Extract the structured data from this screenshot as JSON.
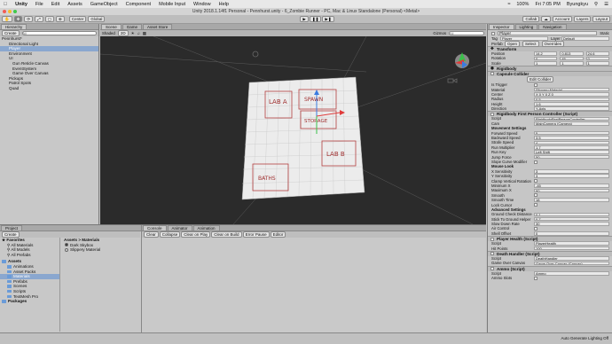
{
  "menubar": {
    "app": "Unity",
    "items": [
      "File",
      "Edit",
      "Assets",
      "GameObject",
      "Component",
      "Mobile Input",
      "Window",
      "Help"
    ],
    "clock": "Fri 7:05 PM",
    "user": "Byungkyu",
    "battery": "100%"
  },
  "window_title": "Unity 2018.1.14f1 Personal - Pennhurst.unity - 6_Zombie Runner - PC, Mac & Linux Standalone (Personal) <Metal>",
  "toolbar": {
    "pivot": "Center",
    "space": "Global",
    "collab": "Collab",
    "account": "Account",
    "layers": "Layers",
    "layout": "Layout"
  },
  "hierarchy": {
    "tab": "Hierarchy",
    "create": "Create",
    "search_placeholder": "All",
    "rows": [
      {
        "label": "Pennhurst*",
        "indent": 0,
        "selected": false
      },
      {
        "label": "Directional Light",
        "indent": 2,
        "selected": false
      },
      {
        "label": "Player",
        "indent": 2,
        "selected": true
      },
      {
        "label": "Environment",
        "indent": 2,
        "selected": false
      },
      {
        "label": "UI",
        "indent": 2,
        "selected": false
      },
      {
        "label": "Gun Reticle Canvas",
        "indent": 3,
        "selected": false
      },
      {
        "label": "EventSystem",
        "indent": 3,
        "selected": false
      },
      {
        "label": "Game Over Canvas",
        "indent": 3,
        "selected": false
      },
      {
        "label": "Pickups",
        "indent": 2,
        "selected": false
      },
      {
        "label": "Patrol Spots",
        "indent": 2,
        "selected": false
      },
      {
        "label": "Quad",
        "indent": 2,
        "selected": false
      }
    ]
  },
  "scene": {
    "tabs": [
      "Scene",
      "Game",
      "Asset Store"
    ],
    "shading": "Shaded",
    "mode2d": "2D",
    "gizmos": "Gizmos",
    "search_placeholder": "All",
    "map_labels": [
      "LAB A",
      "SPAWN",
      "STORAGE",
      "LAB B",
      "BATHS"
    ]
  },
  "inspector": {
    "tabs": [
      "Inspector",
      "Lighting",
      "Navigation"
    ],
    "object_name": "Player",
    "static_label": "Static",
    "tag": "Player",
    "layer": "Default",
    "prefab_buttons": [
      "Open",
      "Select",
      "Overrides"
    ],
    "transform": {
      "title": "Transform",
      "position": {
        "x": "14.2",
        "y": "0.813",
        "z": "24.6"
      },
      "rotation": {
        "x": "0",
        "y": "45",
        "z": "0"
      },
      "scale": {
        "x": "1",
        "y": "1",
        "z": "1"
      }
    },
    "rigidbody": "Rigidbody",
    "capsule": {
      "title": "Capsule Collider",
      "edit_collider": "Edit Collider",
      "rows": [
        {
          "label": "Is Trigger",
          "value": ""
        },
        {
          "label": "Material",
          "value": "Slippery Material"
        },
        {
          "label": "Center",
          "value": "X 0    Y 0    Z 0"
        },
        {
          "label": "Radius",
          "value": "0.5"
        },
        {
          "label": "Height",
          "value": "1.6"
        },
        {
          "label": "Direction",
          "value": "Y-Axis"
        }
      ]
    },
    "fpc": {
      "title": "Rigidbody First Person Controller (Script)",
      "rows": [
        {
          "label": "Script",
          "value": "RigidbodyFirstPersonController"
        },
        {
          "label": "Cam",
          "value": "MainCamera (Camera)"
        }
      ],
      "movement_title": "Movement Settings",
      "movement": [
        {
          "label": "Forward Speed",
          "value": "5"
        },
        {
          "label": "Backward Speed",
          "value": "3.5"
        },
        {
          "label": "Strafe Speed",
          "value": "4"
        },
        {
          "label": "Run Multiplier",
          "value": "1.7"
        },
        {
          "label": "Run Key",
          "value": "Left Shift"
        },
        {
          "label": "Jump Force",
          "value": "50"
        },
        {
          "label": "Slope Curve Modifier",
          "value": ""
        }
      ],
      "mouse_title": "Mouse Look",
      "mouse": [
        {
          "label": "X Sensitivity",
          "value": "3"
        },
        {
          "label": "Y Sensitivity",
          "value": "3"
        },
        {
          "label": "Clamp Vertical Rotation",
          "value": ""
        },
        {
          "label": "Minimum X",
          "value": "-45"
        },
        {
          "label": "Maximum X",
          "value": "90"
        },
        {
          "label": "Smooth",
          "value": ""
        },
        {
          "label": "Smooth Time",
          "value": "18"
        },
        {
          "label": "Lock Cursor",
          "value": ""
        }
      ],
      "advanced_title": "Advanced Settings",
      "advanced": [
        {
          "label": "Ground Check Distance",
          "value": "0.1"
        },
        {
          "label": "Stick To Ground Helper",
          "value": "0.7"
        },
        {
          "label": "Slow Down Rate",
          "value": "30"
        },
        {
          "label": "Air Control",
          "value": ""
        },
        {
          "label": "Shell Offset",
          "value": "0"
        }
      ]
    },
    "player_health": {
      "title": "Player Health (Script)",
      "rows": [
        {
          "label": "Script",
          "value": "PlayerHealth"
        },
        {
          "label": "Hit Points",
          "value": "100"
        }
      ]
    },
    "death_handler": {
      "title": "Death Handler (Script)",
      "rows": [
        {
          "label": "Script",
          "value": "DeathHandler"
        },
        {
          "label": "Game Over Canvas",
          "value": "Game Over Canvas (Canvas)"
        }
      ]
    },
    "ammo": {
      "title": "Ammo (Script)",
      "rows": [
        {
          "label": "Script",
          "value": "Ammo"
        },
        {
          "label": "Ammo Slots",
          "value": ""
        }
      ]
    }
  },
  "project": {
    "tabs": [
      "Project",
      "Console",
      "Animator",
      "Animation"
    ],
    "create": "Create",
    "favorites_title": "Favorites",
    "favorites": [
      "All Materials",
      "All Models",
      "All Prefabs"
    ],
    "assets_title": "Assets",
    "folders": [
      "Animations",
      "Asset Packs",
      "Materials",
      "Prefabs",
      "Scenes",
      "Scripts",
      "TextMesh Pro"
    ],
    "packages": "Packages",
    "breadcrumb": "Assets > Materials",
    "files": [
      "Dark Skybox",
      "Slippery Material"
    ],
    "console_buttons": [
      "Clear",
      "Collapse",
      "Clear on Play",
      "Clear on Build",
      "Error Pause",
      "Editor"
    ]
  },
  "status": "Auto Generate Lighting Off",
  "colors": {
    "selection": "#8aa7cf",
    "scene_bg": "#2b2b2b",
    "panel": "#c8c8c8"
  }
}
